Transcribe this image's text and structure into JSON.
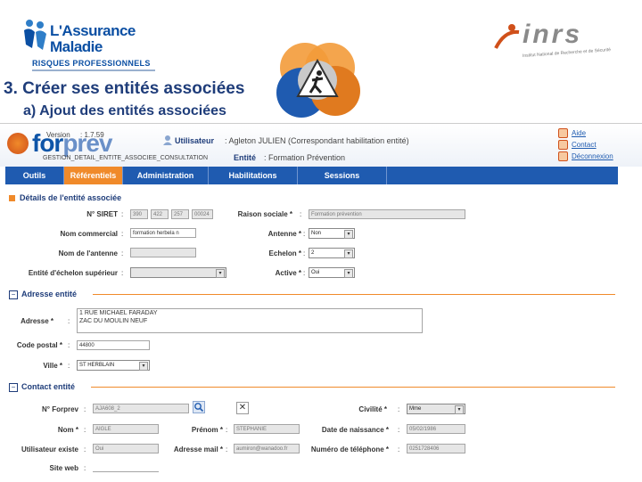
{
  "slide": {
    "title": "3.  Créer ses entités associées",
    "subtitle": "a)   Ajout des entités associées",
    "assurance_logo": {
      "line1": "L'Assurance",
      "line2": "Maladie",
      "sub": "RISQUES PROFESSIONNELS"
    },
    "inrs_logo": {
      "text": "inrs",
      "sub": "Institut National de Recherche et de Sécurité"
    }
  },
  "app": {
    "logo": {
      "part1": "for",
      "part2": "prev"
    },
    "version_label": "Version",
    "version_value": ": 1.7.59",
    "screen_id": "GESTION_DETAIL_ENTITE_ASSOCIEE_CONSULTATION",
    "user_label": "Utilisateur",
    "user_value": ": Agleton JULIEN (Correspondant habilitation entité)",
    "entity_label": "Entité",
    "entity_value": ": Formation Prévention",
    "links": [
      "Aide",
      "Contact",
      "Déconnexion"
    ],
    "menu": [
      {
        "label": "Outils",
        "active": false
      },
      {
        "label": "Référentiels",
        "active": true
      },
      {
        "label": "Administration",
        "active": false
      },
      {
        "label": "Habilitations",
        "active": false
      },
      {
        "label": "Sessions",
        "active": false
      }
    ],
    "details": {
      "title": "Détails de l'entité associée",
      "siret_label": "N° SIRET",
      "siret_parts": [
        "390",
        "422",
        "257",
        "00024"
      ],
      "raison_label": "Raison sociale *",
      "raison_value": "Formation prévention",
      "nom_commercial_label": "Nom commercial",
      "nom_commercial_value": "formation herbela n",
      "antenne_label": "Antenne *",
      "antenne_value": "Non",
      "nom_antenne_label": "Nom de l'antenne",
      "nom_antenne_value": "",
      "echelon_label": "Echelon *",
      "echelon_value": "2",
      "entite_sup_label": "Entité d'échelon supérieur",
      "entite_sup_value": "",
      "active_label": "Active *",
      "active_value": "Oui"
    },
    "adresse": {
      "title": "Adresse entité",
      "adresse_label": "Adresse *",
      "adresse_line1": "1 RUE MICHAEL FARADAY",
      "adresse_line2": "ZAC DU MOULIN NEUF",
      "cp_label": "Code postal *",
      "cp_value": "44800",
      "ville_label": "Ville *",
      "ville_value": "ST HERBLAIN"
    },
    "contact": {
      "title": "Contact entité",
      "forprev_label": "N° Forprev",
      "forprev_value": "AJA608_2",
      "civilite_label": "Civilité *",
      "civilite_value": "Mme",
      "nom_label": "Nom *",
      "nom_value": "AIGLE",
      "prenom_label": "Prénom *",
      "prenom_value": "STEPHANIE",
      "naissance_label": "Date de naissance *",
      "naissance_value": "05/02/1986",
      "util_label": "Utilisateur existe",
      "util_value": "Oui",
      "mail_label": "Adresse mail *",
      "mail_value": "aumiron@wanadoo.fr",
      "tel_label": "Numéro de téléphone *",
      "tel_value": "0251728406",
      "site_label": "Site web",
      "site_value": ""
    }
  }
}
